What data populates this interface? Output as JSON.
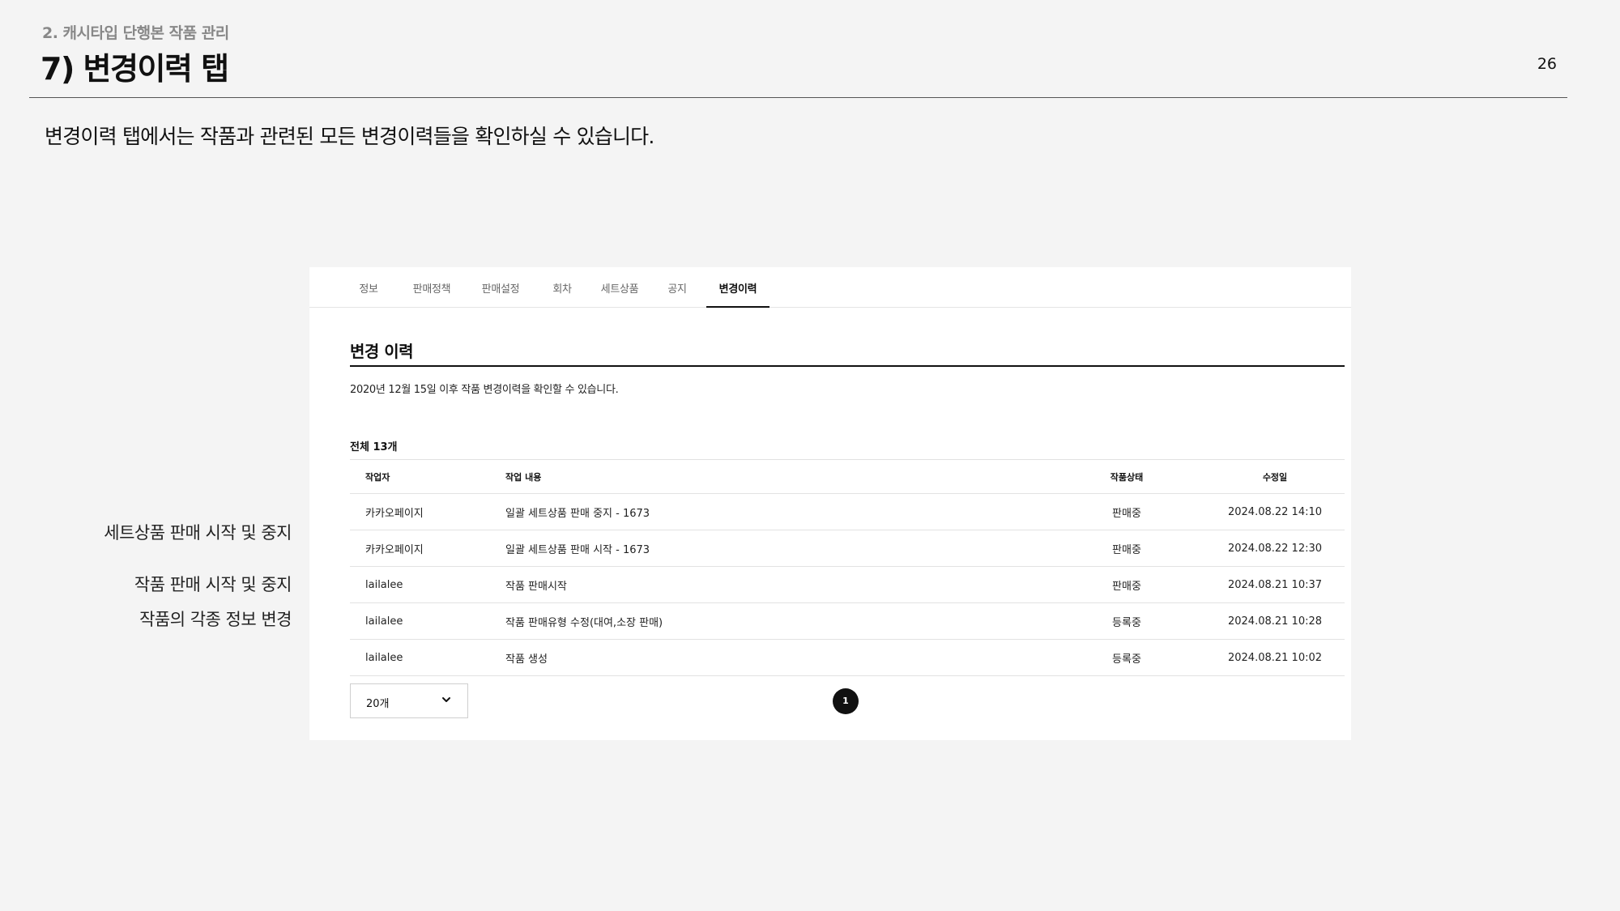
{
  "slide": {
    "section_label": "2. 캐시타입 단행본 작품 관리",
    "title": "7) 변경이력 탭",
    "page_number": "26",
    "intro": "변경이력 탭에서는 작품과 관련된 모든 변경이력들을 확인하실 수 있습니다.",
    "annotations": [
      "세트상품 판매 시작 및 중지",
      "작품 판매 시작 및 중지",
      "작품의 각종 정보 변경"
    ]
  },
  "tabs": [
    "정보",
    "판매정책",
    "판매설정",
    "회차",
    "세트상품",
    "공지",
    "변경이력"
  ],
  "active_tab": "변경이력",
  "history": {
    "title": "변경 이력",
    "description": "2020년 12월 15일 이후 작품 변경이력을 확인할 수 있습니다.",
    "total": "전체 13개",
    "columns": {
      "worker": "작업자",
      "content": "작업 내용",
      "status": "작품상태",
      "date": "수정일"
    },
    "rows": [
      {
        "worker": "카카오페이지",
        "content": "일괄 세트상품 판매 중지 - 1673",
        "status": "판매중",
        "date": "2024.08.22 14:10"
      },
      {
        "worker": "카카오페이지",
        "content": "일괄 세트상품 판매 시작 - 1673",
        "status": "판매중",
        "date": "2024.08.22 12:30"
      },
      {
        "worker": "lailalee",
        "content": "작품 판매시작",
        "status": "판매중",
        "date": "2024.08.21 10:37"
      },
      {
        "worker": "lailalee",
        "content": "작품 판매유형 수정(대여,소장 판매)",
        "status": "등록중",
        "date": "2024.08.21 10:28"
      },
      {
        "worker": "lailalee",
        "content": "작품 생성",
        "status": "등록중",
        "date": "2024.08.21 10:02"
      }
    ]
  },
  "pagination": {
    "page_size": "20개",
    "current_page": "1"
  },
  "icons": {
    "dropdown": "chevron-down-icon"
  },
  "colors": {
    "background": "#f4f4f4",
    "panel": "#ffffff",
    "accent": "#111111",
    "muted": "#888888"
  }
}
